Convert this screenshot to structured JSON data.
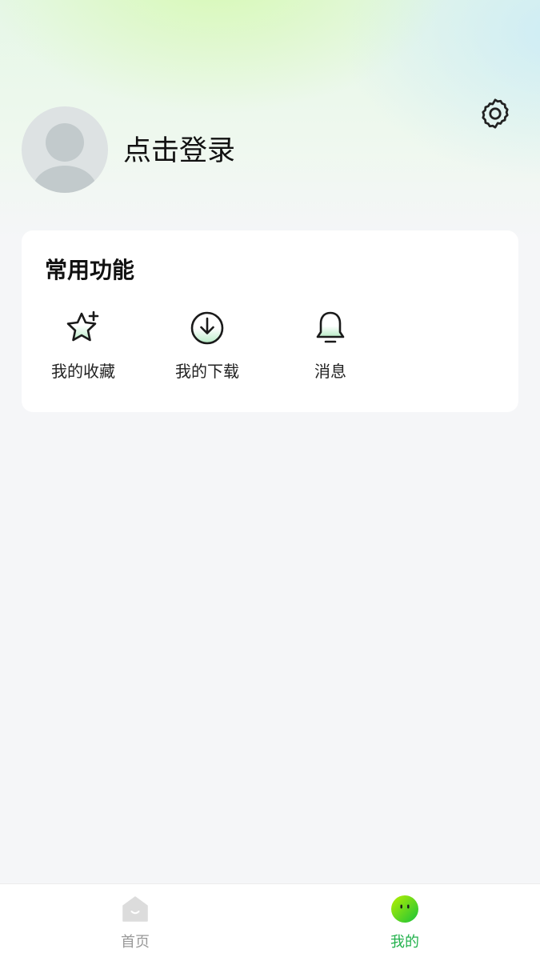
{
  "header": {
    "login_text": "点击登录",
    "avatar_icon": "user-avatar-placeholder",
    "settings_icon": "gear-icon"
  },
  "common_functions": {
    "title": "常用功能",
    "items": [
      {
        "label": "我的收藏",
        "icon": "star-plus-icon"
      },
      {
        "label": "我的下载",
        "icon": "download-circle-icon"
      },
      {
        "label": "消息",
        "icon": "bell-icon"
      }
    ]
  },
  "tabbar": {
    "tabs": [
      {
        "label": "首页",
        "icon": "home-icon",
        "active": false
      },
      {
        "label": "我的",
        "icon": "face-icon",
        "active": true
      }
    ]
  },
  "colors": {
    "accent": "#22b14c",
    "inactive": "#999999",
    "page_bg": "#f5f6f8"
  }
}
